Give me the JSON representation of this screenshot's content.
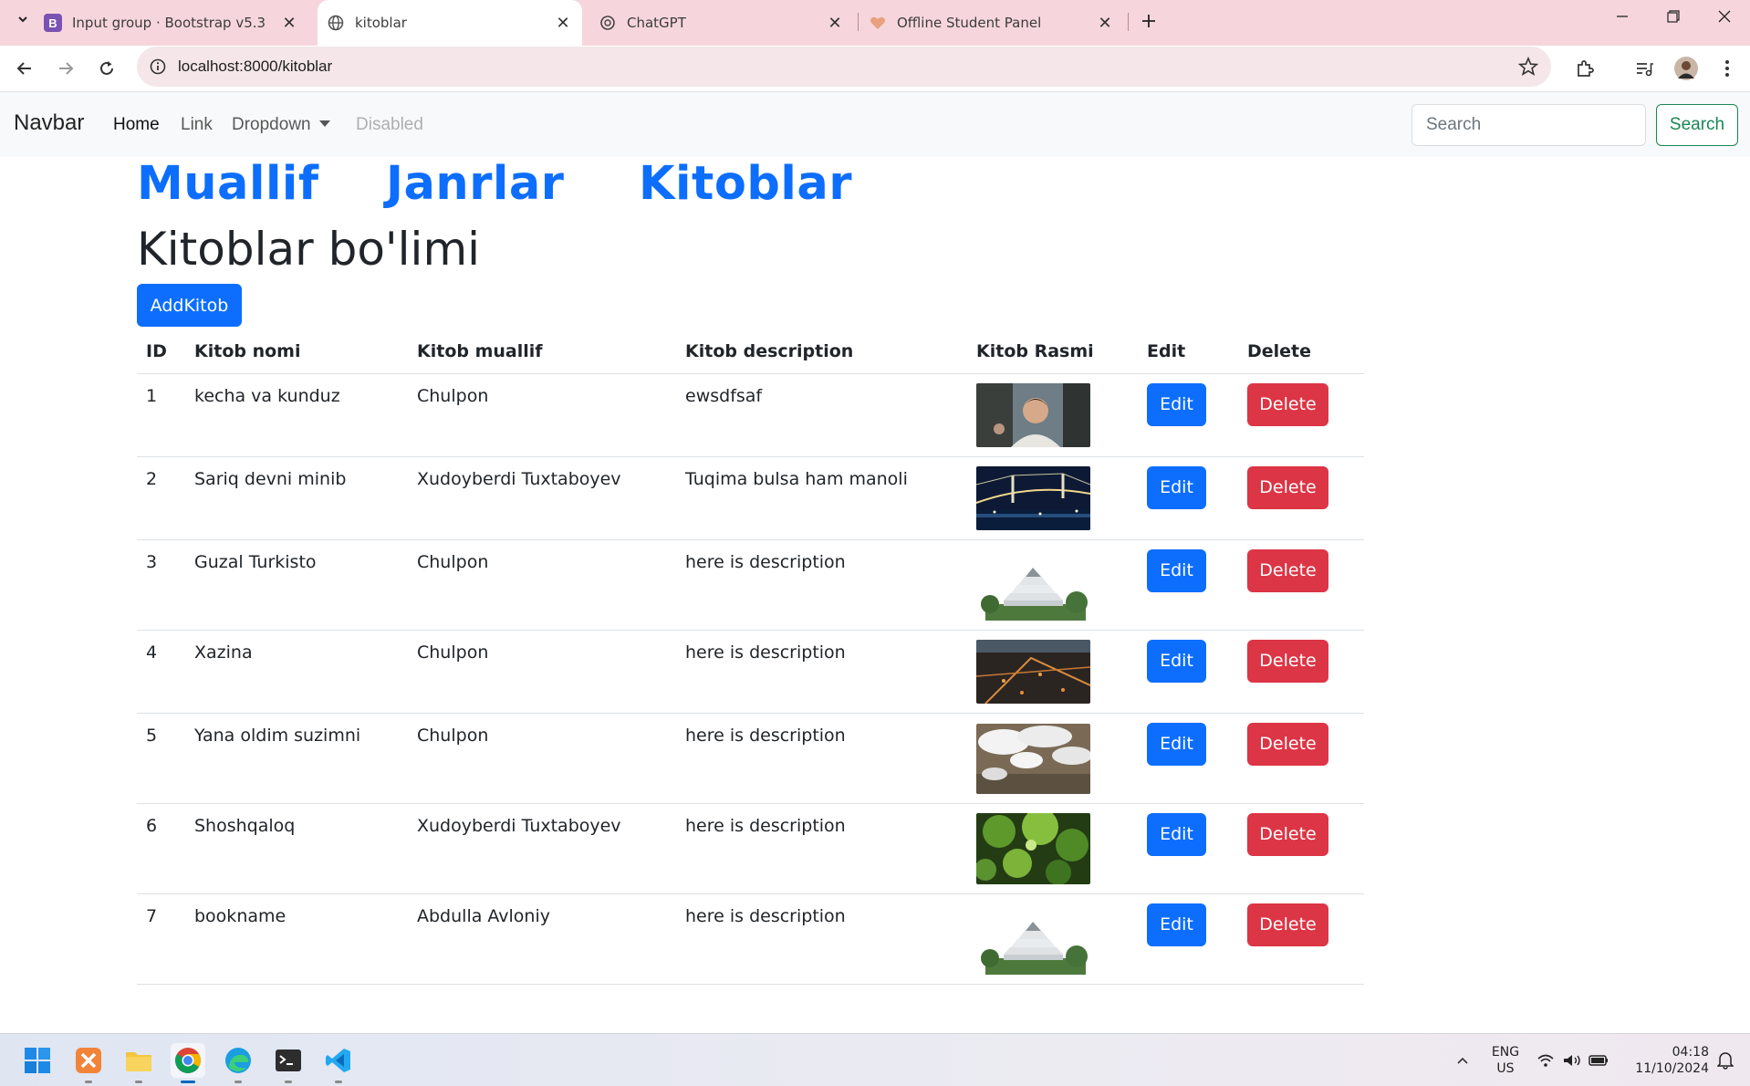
{
  "browser": {
    "tabs": [
      {
        "label": "Input group · Bootstrap v5.3",
        "icon": "bootstrap-icon"
      },
      {
        "label": "kitoblar",
        "icon": "globe-icon",
        "active": true
      },
      {
        "label": "ChatGPT",
        "icon": "chatgpt-icon"
      },
      {
        "label": "Offline Student Panel",
        "icon": "heart-icon"
      }
    ],
    "url": "localhost:8000/kitoblar"
  },
  "navbar": {
    "brand": "Navbar",
    "links": [
      "Home",
      "Link",
      "Dropdown",
      "Disabled"
    ],
    "search_placeholder": "Search",
    "search_button": "Search"
  },
  "sections": [
    "Muallif",
    "Janrlar",
    "Kitoblar"
  ],
  "page_title": "Kitoblar bo'limi",
  "add_button": "AddKitob",
  "table": {
    "headers": [
      "ID",
      "Kitob nomi",
      "Kitob muallif",
      "Kitob description",
      "Kitob Rasmi",
      "Edit",
      "Delete"
    ],
    "rows": [
      {
        "id": "1",
        "name": "kecha va kunduz",
        "author": "Chulpon",
        "description": "ewsdfsaf",
        "image": "portrait-photo"
      },
      {
        "id": "2",
        "name": "Sariq devni minib",
        "author": "Xudoyberdi Tuxtaboyev",
        "description": "Tuqima bulsa ham manoli",
        "image": "bridge-night-photo"
      },
      {
        "id": "3",
        "name": "Guzal Turkisto",
        "author": "Chulpon",
        "description": "here is description",
        "image": "castle-photo"
      },
      {
        "id": "4",
        "name": "Xazina",
        "author": "Chulpon",
        "description": "here is description",
        "image": "city-night-photo"
      },
      {
        "id": "5",
        "name": "Yana oldim suzimni",
        "author": "Chulpon",
        "description": "here is description",
        "image": "clouds-aerial-photo"
      },
      {
        "id": "6",
        "name": "Shoshqaloq",
        "author": "Xudoyberdi Tuxtaboyev",
        "description": "here is description",
        "image": "green-leaves-photo"
      },
      {
        "id": "7",
        "name": "bookname",
        "author": "Abdulla Avloniy",
        "description": "here is description",
        "image": "castle-photo"
      }
    ],
    "edit_label": "Edit",
    "delete_label": "Delete"
  },
  "taskbar": {
    "language": "ENG",
    "region": "US",
    "time": "04:18",
    "date": "11/10/2024"
  },
  "colors": {
    "primary": "#0d6efd",
    "danger": "#dc3545",
    "success": "#198754",
    "tabbar": "#f6d6dc"
  }
}
